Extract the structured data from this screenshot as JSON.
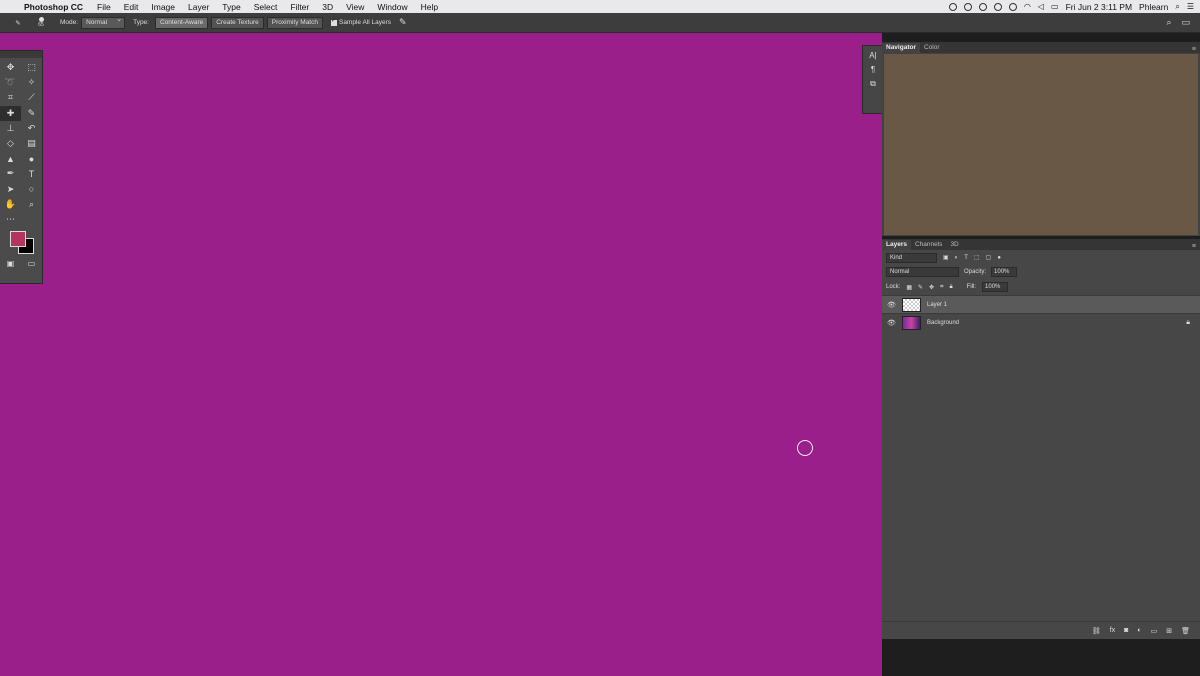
{
  "menubar": {
    "apple": "",
    "app": "Photoshop CC",
    "items": [
      "File",
      "Edit",
      "Image",
      "Layer",
      "Type",
      "Select",
      "Filter",
      "3D",
      "View",
      "Window",
      "Help"
    ],
    "datetime": "Fri Jun 2  3:11 PM",
    "user": "Phlearn"
  },
  "options": {
    "brush_size": "65",
    "mode_label": "Mode:",
    "mode_value": "Normal",
    "type_label": "Type:",
    "type_buttons": [
      "Content-Aware",
      "Create Texture",
      "Proximity Match"
    ],
    "sample_label": "Sample All Layers"
  },
  "tools": [
    "move",
    "marquee",
    "lasso",
    "magic-wand",
    "crop",
    "eyedropper",
    "spot-healing",
    "brush",
    "clone-stamp",
    "history-brush",
    "eraser",
    "gradient",
    "blur",
    "dodge",
    "pen",
    "type",
    "path-selection",
    "ellipse",
    "hand",
    "zoom",
    "more"
  ],
  "colors": {
    "foreground": "#b3345f",
    "background": "#000000"
  },
  "navigator": {
    "tabs": [
      "Navigator",
      "Color"
    ]
  },
  "layers": {
    "tabs": [
      "Layers",
      "Channels",
      "3D"
    ],
    "filter": "Kind",
    "blend_mode": "Normal",
    "opacity_label": "Opacity:",
    "opacity_value": "100%",
    "lock_label": "Lock:",
    "fill_label": "Fill:",
    "fill_value": "100%",
    "items": [
      {
        "name": "Layer 1",
        "selected": true
      },
      {
        "name": "Background",
        "locked": true
      }
    ]
  }
}
